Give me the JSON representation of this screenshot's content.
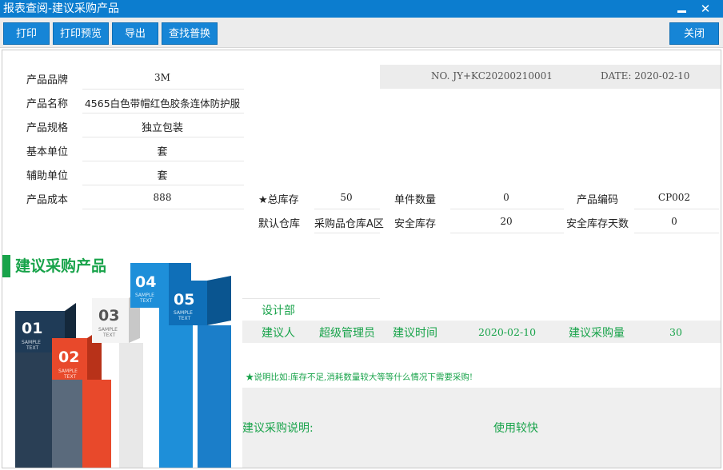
{
  "window": {
    "title": "报表查阅-建议采购产品"
  },
  "toolbar": {
    "print": "打印",
    "print_preview": "打印预览",
    "export": "导出",
    "find_replace": "查找普换",
    "close": "关闭"
  },
  "header": {
    "no": "NO. JY+KC20200210001",
    "date": "DATE: 2020-02-10"
  },
  "product": {
    "brand_label": "产品品牌",
    "brand": "3M",
    "name_label": "产品名称",
    "name": "4565白色带帽红色胶条连体防护服",
    "spec_label": "产品规格",
    "spec": "独立包装",
    "base_unit_label": "基本单位",
    "base_unit": "套",
    "aux_unit_label": "辅助单位",
    "aux_unit": "套",
    "cost_label": "产品成本",
    "cost": "888",
    "total_stock_label": "★总库存",
    "total_stock": "50",
    "unit_qty_label": "单件数量",
    "unit_qty": "0",
    "code_label": "产品编码",
    "code": "CP002",
    "default_wh_label": "默认仓库",
    "default_wh": "采购品仓库A区",
    "safety_stock_label": "安全库存",
    "safety_stock": "20",
    "safety_days_label": "安全库存天数",
    "safety_days": "0"
  },
  "section": {
    "title": "建议采购产品"
  },
  "infographic": {
    "blocks": [
      {
        "num": "01",
        "sub1": "SAMPLE",
        "sub2": "TEXT",
        "color": "#1f3b57"
      },
      {
        "num": "02",
        "sub1": "SAMPLE",
        "sub2": "TEXT",
        "color": "#e8492b"
      },
      {
        "num": "03",
        "sub1": "SAMPLE",
        "sub2": "TEXT",
        "color": "#ededed"
      },
      {
        "num": "04",
        "sub1": "SAMPLE",
        "sub2": "TEXT",
        "color": "#1e8fd9"
      },
      {
        "num": "05",
        "sub1": "SAMPLE",
        "sub2": "TEXT",
        "color": "#0f6fb8"
      }
    ]
  },
  "suggest": {
    "dept": "设计部",
    "suggester_label": "建议人",
    "suggester": "超级管理员",
    "time_label": "建议时间",
    "time": "2020-02-10",
    "qty_label": "建议采购量",
    "qty": "30",
    "note": "★说明比如:库存不足,消耗数量较大等等什么情况下需要采购!",
    "desc_label": "建议采购说明:",
    "desc": "使用较快"
  },
  "colors": {
    "accent": "#0c7dcf",
    "button": "#1685d6",
    "green": "#18a34a"
  }
}
